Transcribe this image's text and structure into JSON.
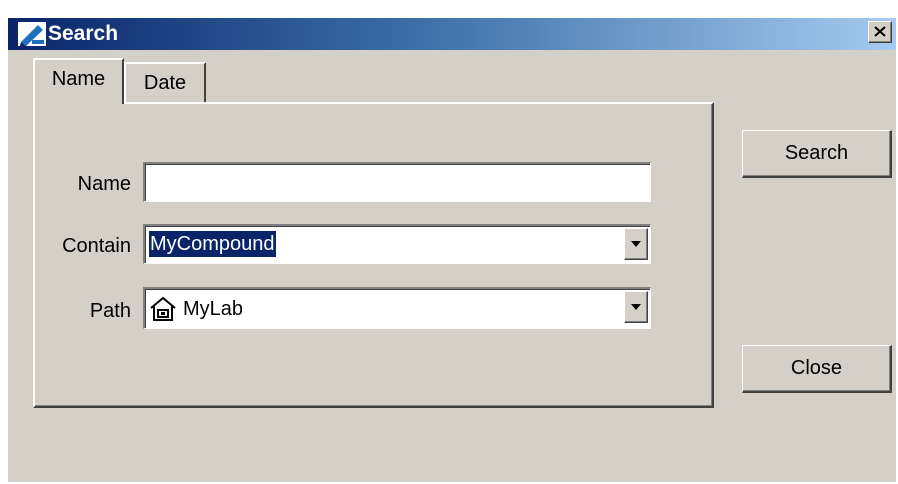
{
  "window": {
    "title": "Search",
    "icon": "pencil-app-icon",
    "close_icon": "close-x-icon"
  },
  "tabs": [
    {
      "label": "Name",
      "active": true
    },
    {
      "label": "Date",
      "active": false
    }
  ],
  "form": {
    "name": {
      "label": "Name",
      "value": ""
    },
    "contain": {
      "label": "Contain",
      "value": "MyCompound",
      "selected": true
    },
    "path": {
      "label": "Path",
      "value": "MyLab",
      "icon": "home-folder-icon"
    }
  },
  "buttons": {
    "search": "Search",
    "close": "Close"
  },
  "colors": {
    "title_start": "#0a246a",
    "title_end": "#a6caf0",
    "face": "#d4d0c8",
    "selection": "#0a246a"
  }
}
